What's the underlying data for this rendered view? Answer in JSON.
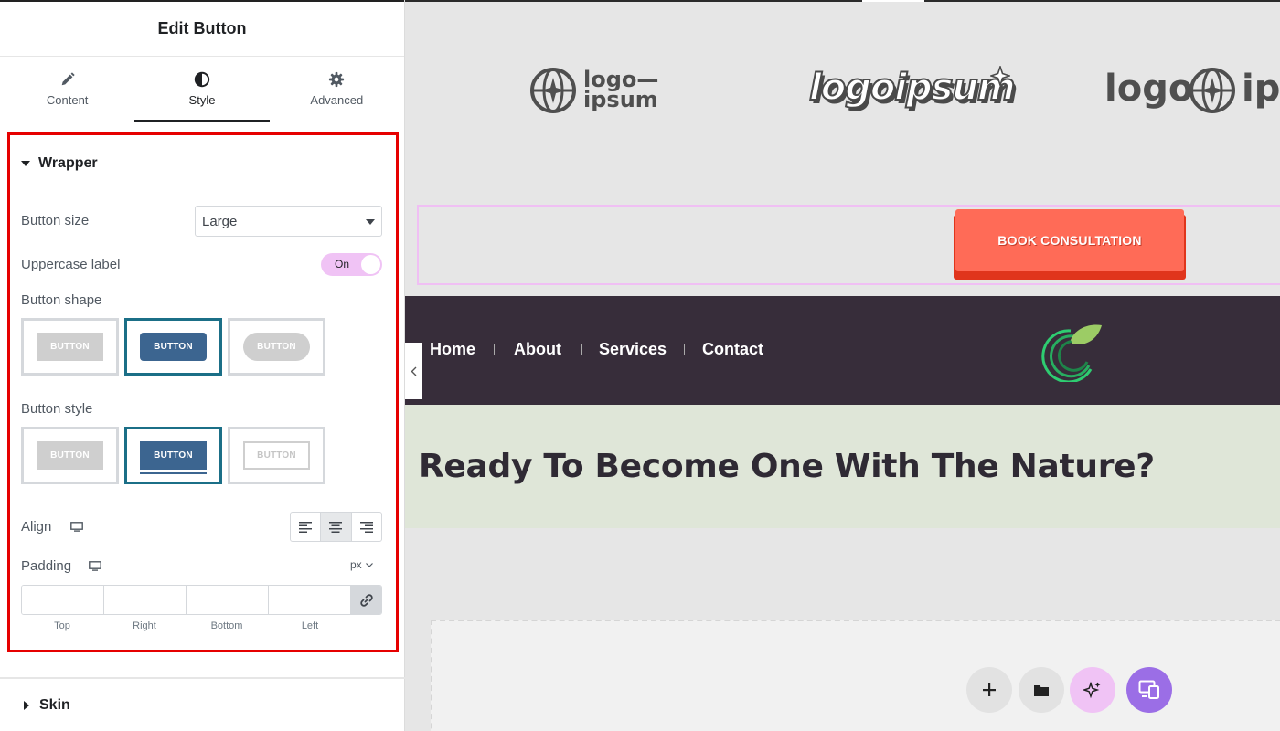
{
  "panel": {
    "title": "Edit Button",
    "tabs": [
      {
        "label": "Content",
        "icon": "pencil-icon",
        "active": false
      },
      {
        "label": "Style",
        "icon": "half-circle-icon",
        "active": true
      },
      {
        "label": "Advanced",
        "icon": "gear-icon",
        "active": false
      }
    ],
    "section": {
      "title": "Wrapper",
      "button_size": {
        "label": "Button size",
        "value": "Large"
      },
      "uppercase": {
        "label": "Uppercase label",
        "state": "On"
      },
      "button_shape": {
        "label": "Button shape",
        "options": [
          "BUTTON",
          "BUTTON",
          "BUTTON"
        ],
        "selected_index": 1
      },
      "button_style": {
        "label": "Button style",
        "options": [
          "BUTTON",
          "BUTTON",
          "BUTTON"
        ],
        "selected_index": 1
      },
      "align": {
        "label": "Align",
        "options": [
          "left",
          "center",
          "right"
        ],
        "selected": "center"
      },
      "padding": {
        "label": "Padding",
        "unit": "px",
        "fields": [
          {
            "label": "Top",
            "value": ""
          },
          {
            "label": "Right",
            "value": ""
          },
          {
            "label": "Bottom",
            "value": ""
          },
          {
            "label": "Left",
            "value": ""
          }
        ]
      }
    },
    "collapsed_section": "Skin"
  },
  "preview": {
    "logos": [
      {
        "line1": "logo—",
        "line2": "ipsum"
      },
      {
        "text": "logoipsum"
      },
      {
        "text_left": "logo",
        "text_right": "ips"
      }
    ],
    "cta_label": "BOOK CONSULTATION",
    "nav": [
      "Home",
      "About",
      "Services",
      "Contact"
    ],
    "hero_title": "Ready To Become One With The Nature?",
    "fab_icons": [
      "plus-icon",
      "folder-icon",
      "sparkle-icon",
      "responsive-icon"
    ]
  },
  "colors": {
    "highlight_border": "#e60000",
    "selected_option": "#1b6f87",
    "toggle_bg": "#f0c3f5",
    "cta": "#ff6b57",
    "nav_bg": "#372d3a",
    "hero_bg": "#dfe6d8",
    "fab_ai": "#f0c3f5",
    "fab_responsive": "#9b6ee6"
  }
}
